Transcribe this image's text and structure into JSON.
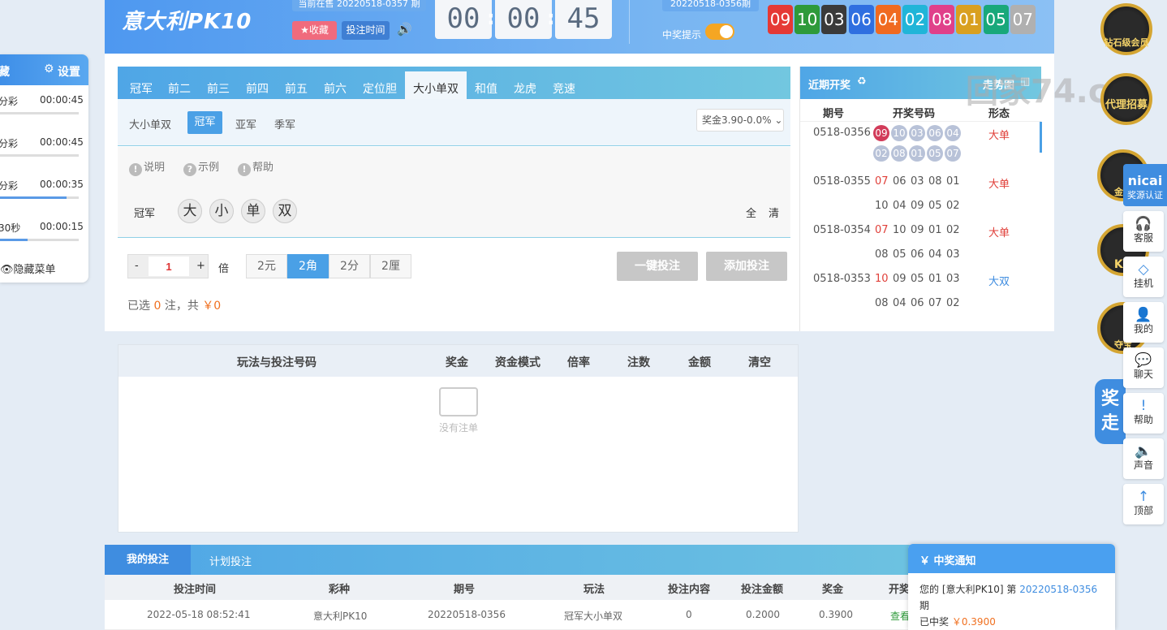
{
  "left_panel": {
    "fav": "藏",
    "settings": "设置",
    "rows": [
      {
        "name": "分彩",
        "time": "00:00:45",
        "progress": 0.0
      },
      {
        "name": "分彩",
        "time": "00:00:45",
        "progress": 0.0
      },
      {
        "name": "分彩",
        "time": "00:00:35",
        "progress": 0.85
      },
      {
        "name": "30秒",
        "time": "00:00:15",
        "progress": 0.35
      }
    ],
    "hide_menu": "隐藏菜单"
  },
  "header": {
    "logo": "意大利PK10",
    "current_issue": "当前在售 20220518-0357 期",
    "fav_button": "★收藏",
    "time_button": "投注时间",
    "countdown": [
      "00",
      "00",
      "45"
    ],
    "prev_issue": "20220518-0356期",
    "win_tip": "中奖提示",
    "balls": [
      {
        "n": "09",
        "c": "#e53935"
      },
      {
        "n": "10",
        "c": "#2e9a3a"
      },
      {
        "n": "03",
        "c": "#3a3a3a"
      },
      {
        "n": "06",
        "c": "#2f6fe0"
      },
      {
        "n": "04",
        "c": "#f06a20"
      },
      {
        "n": "02",
        "c": "#20b5d8"
      },
      {
        "n": "08",
        "c": "#e0408a"
      },
      {
        "n": "01",
        "c": "#d9a020"
      },
      {
        "n": "05",
        "c": "#18a87a"
      },
      {
        "n": "07",
        "c": "#b0b0b0"
      }
    ]
  },
  "tabs": [
    "冠军",
    "前二",
    "前三",
    "前四",
    "前五",
    "前六",
    "定位胆",
    "大小单双",
    "和值",
    "龙虎",
    "竞速"
  ],
  "active_tab": "大小单双",
  "sub": {
    "title": "大小单双",
    "options": [
      "冠军",
      "亚军",
      "季军"
    ],
    "prize": "奖金3.90-0.0%"
  },
  "help": [
    "说明",
    "示例",
    "帮助"
  ],
  "pick": {
    "label": "冠军",
    "balls": [
      "大",
      "小",
      "单",
      "双"
    ],
    "all": "全",
    "clear": "清"
  },
  "bet": {
    "minus": "-",
    "value": "1",
    "plus": "+",
    "multi_label": "倍",
    "units": [
      "2元",
      "2角",
      "2分",
      "2厘"
    ],
    "one_click": "一键投注",
    "add": "添加投注",
    "sel_prefix": "已选",
    "sel_count": "0",
    "sel_mid": "注，共",
    "sel_amount": "￥0"
  },
  "recent": {
    "title": "近期开奖",
    "trend": "走势图",
    "cols": [
      "期号",
      "开奖号码",
      "形态"
    ],
    "rows": [
      {
        "issue": "0518-0356",
        "nums": [
          "09",
          "10",
          "03",
          "06",
          "04",
          "02",
          "08",
          "01",
          "05",
          "07"
        ],
        "form": "大单"
      },
      {
        "issue": "0518-0355",
        "nums": [
          "07",
          "06",
          "03",
          "08",
          "01",
          "10",
          "04",
          "09",
          "05",
          "02"
        ],
        "form": "大单"
      },
      {
        "issue": "0518-0354",
        "nums": [
          "07",
          "10",
          "09",
          "01",
          "02",
          "08",
          "05",
          "06",
          "04",
          "03"
        ],
        "form": "大单"
      },
      {
        "issue": "0518-0353",
        "nums": [
          "10",
          "09",
          "05",
          "01",
          "03",
          "08",
          "04",
          "06",
          "07",
          "02"
        ],
        "form": "大双"
      }
    ]
  },
  "betlist": {
    "cols": [
      "玩法与投注号码",
      "奖金",
      "资金模式",
      "倍率",
      "注数",
      "金额",
      "清空"
    ],
    "empty": "没有注单"
  },
  "bottom": {
    "tab1": "我的投注",
    "tab2": "计划投注",
    "cols": [
      "投注时间",
      "彩种",
      "期号",
      "玩法",
      "投注内容",
      "投注金额",
      "奖金",
      "开奖"
    ],
    "row": [
      "2022-05-18 08:52:41",
      "意大利PK10",
      "20220518-0356",
      "冠军大小单双",
      "0",
      "0.2000",
      "0.3900",
      "查看"
    ]
  },
  "sidebar": {
    "badges": [
      "钻石级会员",
      "代理招募",
      "金牌",
      "KG",
      "夺宝"
    ],
    "nicai": "nicai",
    "auth": "奖源认证",
    "buttons": [
      "客服",
      "挂机",
      "我的",
      "聊天",
      "帮助",
      "声音",
      "顶部"
    ],
    "awards": "奖走"
  },
  "watermark": "回家74.c",
  "notify": {
    "title": "￥ 中奖通知",
    "prefix": "您的 [意大利PK10] 第",
    "issue": "20220518-0356",
    "suffix": "期",
    "line2": "已中奖",
    "amount": "￥0.3900"
  }
}
